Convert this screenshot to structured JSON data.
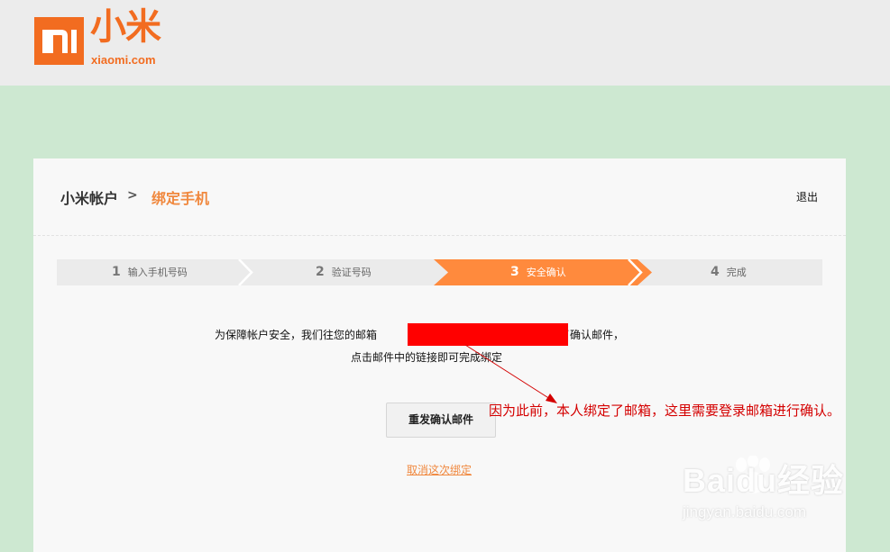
{
  "header": {
    "logo_mark": "mi",
    "logo_text": "小米",
    "logo_domain": "xiaomi.com"
  },
  "breadcrumb": {
    "home": "小米帐户",
    "separator": ">",
    "current": "绑定手机"
  },
  "logout_label": "退出",
  "steps": [
    {
      "num": "1",
      "label": "输入手机号码"
    },
    {
      "num": "2",
      "label": "验证号码"
    },
    {
      "num": "3",
      "label": "安全确认"
    },
    {
      "num": "4",
      "label": "完成"
    }
  ],
  "active_step": 3,
  "message": {
    "line1_prefix": "为保障帐户安全，我们往您的邮箱",
    "line1_suffix": "发送了确认邮件，",
    "line2": "点击邮件中的链接即可完成绑定"
  },
  "resend_button": "重发确认邮件",
  "cancel_link": "取消这次绑定",
  "annotation": "因为此前，本人绑定了邮箱，这里需要登录邮箱进行确认。",
  "watermark": {
    "main": "Baidu经验",
    "sub": "jingyan.baidu.com"
  },
  "colors": {
    "brand": "#f26c20",
    "accent": "#ff8a3d",
    "page_bg": "#cde8d1",
    "annotation": "#d40000"
  }
}
